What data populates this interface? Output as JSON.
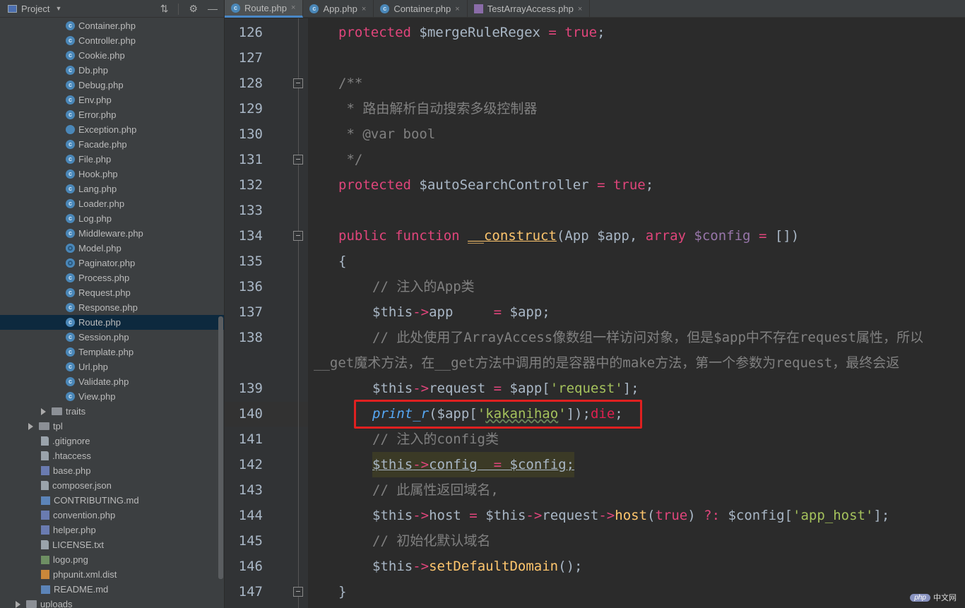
{
  "sidebar": {
    "title": "Project",
    "files": [
      {
        "name": "Container.php",
        "icon": "class-icon"
      },
      {
        "name": "Controller.php",
        "icon": "class-icon"
      },
      {
        "name": "Cookie.php",
        "icon": "class-icon"
      },
      {
        "name": "Db.php",
        "icon": "class-icon"
      },
      {
        "name": "Debug.php",
        "icon": "class-icon"
      },
      {
        "name": "Env.php",
        "icon": "class-icon"
      },
      {
        "name": "Error.php",
        "icon": "class-icon"
      },
      {
        "name": "Exception.php",
        "icon": "exception-icon"
      },
      {
        "name": "Facade.php",
        "icon": "class-icon"
      },
      {
        "name": "File.php",
        "icon": "class-icon"
      },
      {
        "name": "Hook.php",
        "icon": "class-icon"
      },
      {
        "name": "Lang.php",
        "icon": "class-icon"
      },
      {
        "name": "Loader.php",
        "icon": "class-icon"
      },
      {
        "name": "Log.php",
        "icon": "class-icon"
      },
      {
        "name": "Middleware.php",
        "icon": "class-icon"
      },
      {
        "name": "Model.php",
        "icon": "abstract-class-icon"
      },
      {
        "name": "Paginator.php",
        "icon": "abstract-class-icon"
      },
      {
        "name": "Process.php",
        "icon": "class-icon"
      },
      {
        "name": "Request.php",
        "icon": "class-icon"
      },
      {
        "name": "Response.php",
        "icon": "class-icon"
      },
      {
        "name": "Route.php",
        "icon": "class-icon",
        "selected": true
      },
      {
        "name": "Session.php",
        "icon": "class-icon"
      },
      {
        "name": "Template.php",
        "icon": "class-icon"
      },
      {
        "name": "Url.php",
        "icon": "class-icon"
      },
      {
        "name": "Validate.php",
        "icon": "class-icon"
      },
      {
        "name": "View.php",
        "icon": "class-icon"
      }
    ],
    "traits_folder": "traits",
    "tpl_folder": "tpl",
    "root_files": [
      {
        "name": ".gitignore",
        "icon": "text-file-icon"
      },
      {
        "name": ".htaccess",
        "icon": "text-file-icon"
      },
      {
        "name": "base.php",
        "icon": "php-file-icon"
      },
      {
        "name": "composer.json",
        "icon": "json-file-icon"
      },
      {
        "name": "CONTRIBUTING.md",
        "icon": "markdown-file-icon"
      },
      {
        "name": "convention.php",
        "icon": "php-file-icon"
      },
      {
        "name": "helper.php",
        "icon": "php-file-icon"
      },
      {
        "name": "LICENSE.txt",
        "icon": "text-file-icon"
      },
      {
        "name": "logo.png",
        "icon": "image-file-icon"
      },
      {
        "name": "phpunit.xml.dist",
        "icon": "xml-file-icon"
      },
      {
        "name": "README.md",
        "icon": "markdown-file-icon"
      }
    ],
    "uploads_folder": "uploads"
  },
  "tabs": [
    {
      "label": "Route.php",
      "active": true,
      "icon": "class-icon"
    },
    {
      "label": "App.php",
      "active": false,
      "icon": "class-icon"
    },
    {
      "label": "Container.php",
      "active": false,
      "icon": "class-icon"
    },
    {
      "label": "TestArrayAccess.php",
      "active": false,
      "icon": "php-file-icon"
    }
  ],
  "editor": {
    "line_numbers": [
      "126",
      "127",
      "128",
      "129",
      "130",
      "131",
      "132",
      "133",
      "134",
      "135",
      "136",
      "137",
      "138",
      "",
      "139",
      "140",
      "141",
      "142",
      "143",
      "144",
      "145",
      "146",
      "147"
    ],
    "lines": {
      "l126": [
        "protected",
        " $mergeRuleRegex",
        " = ",
        "true",
        ";"
      ],
      "l128": "/**",
      "l129": " * 路由解析自动搜索多级控制器",
      "l130": " * @var bool",
      "l131": " */",
      "l132": [
        "protected",
        " $autoSearchController",
        " = ",
        "true",
        ";"
      ],
      "l134": [
        "public",
        " ",
        "function",
        " ",
        "__construct",
        "(App ",
        "$app",
        ", ",
        "array",
        " ",
        "$config",
        " = ",
        "[])"
      ],
      "l135": "{",
      "l136": "// 注入的App类",
      "l137": [
        "$this",
        "->",
        "app",
        "     = ",
        "$app",
        ";"
      ],
      "l138a": "// 此处使用了ArrayAccess像数组一样访问对象，但是$app中不存在request属性，所以",
      "l138b": "__get魔术方法，在__get方法中调用的是容器中的make方法，第一个参数为request，最终会返",
      "l139": [
        "$this",
        "->",
        "request",
        " = ",
        "$app",
        "[",
        "'request'",
        "];"
      ],
      "l140": [
        "print_r",
        "(",
        "$app",
        "[",
        "'",
        "kakanihao",
        "'",
        "]);",
        "die",
        ";"
      ],
      "l141": "// 注入的config类",
      "l142": [
        "$this",
        "->",
        "config",
        "  = ",
        "$config",
        ";"
      ],
      "l143": "// 此属性返回域名,",
      "l144": [
        "$this",
        "->",
        "host",
        " = ",
        "$this",
        "->",
        "request",
        "->",
        "host",
        "(",
        "true",
        ") ",
        "?:",
        " ",
        "$config",
        "[",
        "'app_host'",
        "];"
      ],
      "l145": "// 初始化默认域名",
      "l146": [
        "$this",
        "->",
        "setDefaultDomain",
        "();"
      ],
      "l147": "}"
    }
  },
  "watermark": {
    "logo": "php",
    "text": "中文网"
  },
  "colors": {
    "keyword": "#cc7832",
    "variable": "#9876aa",
    "string": "#6a8759",
    "comment": "#808080",
    "function": "#ffc66d",
    "highlight_box": "#e02020"
  }
}
